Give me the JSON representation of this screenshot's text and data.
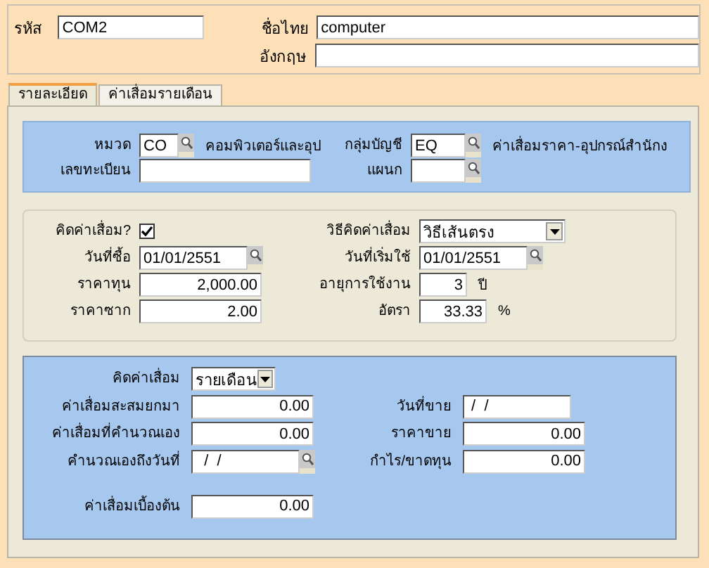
{
  "header": {
    "code": {
      "label": "รหัส",
      "value": "COM2"
    },
    "name_thai": {
      "label": "ชื่อไทย",
      "value": "computer"
    },
    "name_english": {
      "label": "อังกฤษ"
    }
  },
  "tabs": [
    {
      "label": "รายละเอียด",
      "selected": true
    },
    {
      "label": "ค่าเสื่อมรายเดือน",
      "selected": false
    }
  ],
  "sections": [
    {
      "kind": "classification",
      "rows": [
        {
          "left": [
            {
              "kind": "label",
              "text": "หมวด"
            },
            {
              "kind": "code_field",
              "value": "CO"
            },
            {
              "kind": "lookup_button"
            },
            {
              "kind": "text",
              "text": "คอมพิวเตอร์และอุป"
            }
          ],
          "right": [
            {
              "kind": "label",
              "text": "กลุ่มบัญชี"
            },
            {
              "kind": "group_field",
              "value": "EQ"
            },
            {
              "kind": "lookup_button"
            },
            {
              "kind": "text",
              "text": "ค่าเสื่อมราคา-อุปกรณ์สำนักง"
            }
          ]
        },
        {
          "left": [
            {
              "kind": "label",
              "text": "เลขทะเบียน"
            },
            {
              "kind": "wide_field"
            }
          ],
          "right": [
            {
              "kind": "label",
              "text": "แผนก"
            },
            {
              "kind": "group_field"
            },
            {
              "kind": "lookup_button"
            }
          ]
        }
      ]
    },
    {
      "kind": "depreciation",
      "rows": [
        {
          "left": [
            {
              "kind": "label",
              "text": "คิดค่าเสื่อม?"
            },
            {
              "kind": "checkbox",
              "checked": true
            }
          ],
          "right": [
            {
              "kind": "label",
              "text": "วิธีคิดค่าเสื่อม"
            },
            {
              "kind": "method_dropdown",
              "value": "วิธีเส้นตรง"
            }
          ]
        },
        {
          "left": [
            {
              "kind": "label",
              "text": "วันที่ซื้อ"
            },
            {
              "kind": "date_field",
              "value": "01/01/2551"
            },
            {
              "kind": "lookup_button"
            }
          ],
          "right": [
            {
              "kind": "label",
              "text": "วันที่เริ่มใช้"
            },
            {
              "kind": "date_field",
              "value": "01/01/2551"
            },
            {
              "kind": "lookup_button"
            }
          ]
        },
        {
          "left": [
            {
              "kind": "label",
              "text": "ราคาทุน"
            },
            {
              "kind": "amount_field",
              "value": "2,000.00"
            }
          ],
          "right": [
            {
              "kind": "label",
              "text": "อายุการใช้งาน"
            },
            {
              "kind": "year_field",
              "value": "3"
            },
            {
              "kind": "text",
              "text": "ปี"
            }
          ]
        },
        {
          "left": [
            {
              "kind": "label",
              "text": "ราคาซาก"
            },
            {
              "kind": "amount_field",
              "value": "2.00"
            }
          ],
          "right": [
            {
              "kind": "label",
              "text": "อัตรา"
            },
            {
              "kind": "rate_field",
              "value": "33.33"
            },
            {
              "kind": "text",
              "text": "%"
            }
          ]
        }
      ]
    },
    {
      "kind": "sale",
      "rows": [
        {
          "left": [
            {
              "kind": "label",
              "text": "คิดค่าเสื่อม"
            },
            {
              "kind": "period_dropdown",
              "value": "รายเดือน"
            }
          ],
          "right": []
        },
        {
          "left": [
            {
              "kind": "label",
              "text": "ค่าเสื่อมสะสมยกมา"
            },
            {
              "kind": "amount_field",
              "value": "0.00"
            }
          ],
          "right": [
            {
              "kind": "label",
              "text": "วันที่ขาย"
            },
            {
              "kind": "date_field",
              "value": " /  /"
            }
          ]
        },
        {
          "left": [
            {
              "kind": "label",
              "text": "ค่าเสื่อมที่คำนวณเอง"
            },
            {
              "kind": "amount_field",
              "value": "0.00"
            }
          ],
          "right": [
            {
              "kind": "label",
              "text": "ราคาขาย"
            },
            {
              "kind": "amount_field",
              "value": "0.00"
            }
          ]
        },
        {
          "left": [
            {
              "kind": "label",
              "text": "คำนวณเองถึงวันที่"
            },
            {
              "kind": "date_field",
              "value": "  /  /"
            },
            {
              "kind": "lookup_button"
            }
          ],
          "right": [
            {
              "kind": "label",
              "text": "กำไร/ขาดทุน"
            },
            {
              "kind": "amount_field",
              "value": "0.00"
            }
          ]
        },
        {
          "left": [
            {
              "kind": "label",
              "text": "ค่าเสื่อมเบื้องต้น"
            },
            {
              "kind": "amount_field",
              "value": "0.00"
            }
          ],
          "right": []
        }
      ]
    }
  ]
}
